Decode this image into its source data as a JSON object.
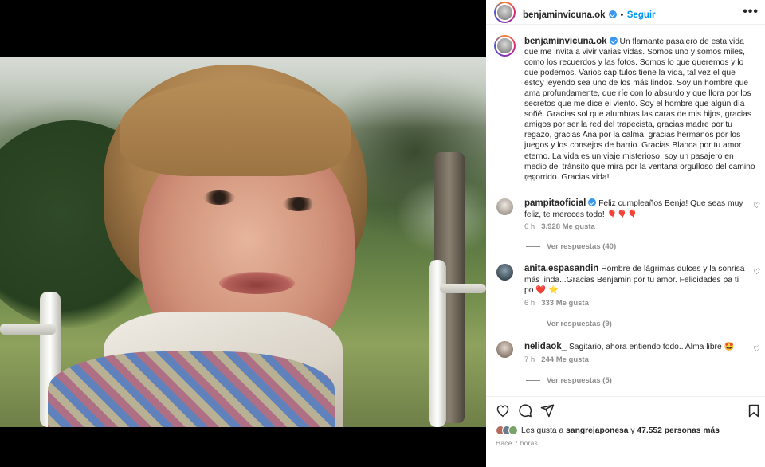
{
  "post": {
    "author": "benjaminvicuna.ok",
    "follow_label": "Seguir",
    "dot": "•",
    "more_label": "•••",
    "caption": "Un flamante pasajero de esta vida que me invita a vivir varias vidas. Somos uno y somos miles, como los recuerdos y las fotos. Somos lo que queremos y lo que podemos. Varios capítulos tiene la vida, tal vez el que estoy leyendo sea uno de los más lindos. Soy un hombre que ama profundamente, que ríe con lo absurdo y que llora por los secretos que me dice el viento. Soy el hombre que algún día soñé. Gracias sol que alumbras las caras de mis hijos, gracias amigos por ser la red del trapecista, gracias madre por tu regazo, gracias Ana por la calma, gracias hermanos por los juegos y los consejos de barrio. Gracias Blanca por tu amor eterno. La vida es un viaje misterioso, soy un pasajero en medio del tránsito que mira por la ventana orgulloso del camino recorrido. Gracias vida!",
    "caption_time": "7 h"
  },
  "comments": [
    {
      "user": "pampitaoficial",
      "verified": true,
      "text": "Feliz cumpleaños Benja! Que seas muy feliz, te mereces todo! 🎈🎈🎈",
      "time": "6 h",
      "likes": "3.928 Me gusta",
      "replies": "Ver respuestas (40)",
      "avatar_color": "#c9c4bf"
    },
    {
      "user": "anita.espasandin",
      "verified": false,
      "text": "Hombre de lágrimas dulces y la sonrisa más linda...Gracias Benjamin por tu amor. Felicidades pa ti po ❤️ ⭐",
      "time": "6 h",
      "likes": "333 Me gusta",
      "replies": "Ver respuestas (9)",
      "avatar_color": "#5c6f7d"
    },
    {
      "user": "nelidaok_",
      "verified": false,
      "text": "Sagitario, ahora entiendo todo.. Alma libre 🤩",
      "time": "7 h",
      "likes": "244 Me gusta",
      "replies": "Ver respuestas (5)",
      "avatar_color": "#b9a89b"
    }
  ],
  "footer": {
    "likes_prefix": "Les gusta a ",
    "liked_by": "sangrejaponesa",
    "likes_mid": " y ",
    "likes_count": "47.552 personas más",
    "ago": "Hace 7 horas",
    "icons": [
      "heart-icon",
      "comment-icon",
      "share-icon",
      "bookmark-icon"
    ]
  },
  "colors": {
    "accent": "#0095f6",
    "verified": "#3897f0",
    "muted": "#8e8e8e"
  }
}
